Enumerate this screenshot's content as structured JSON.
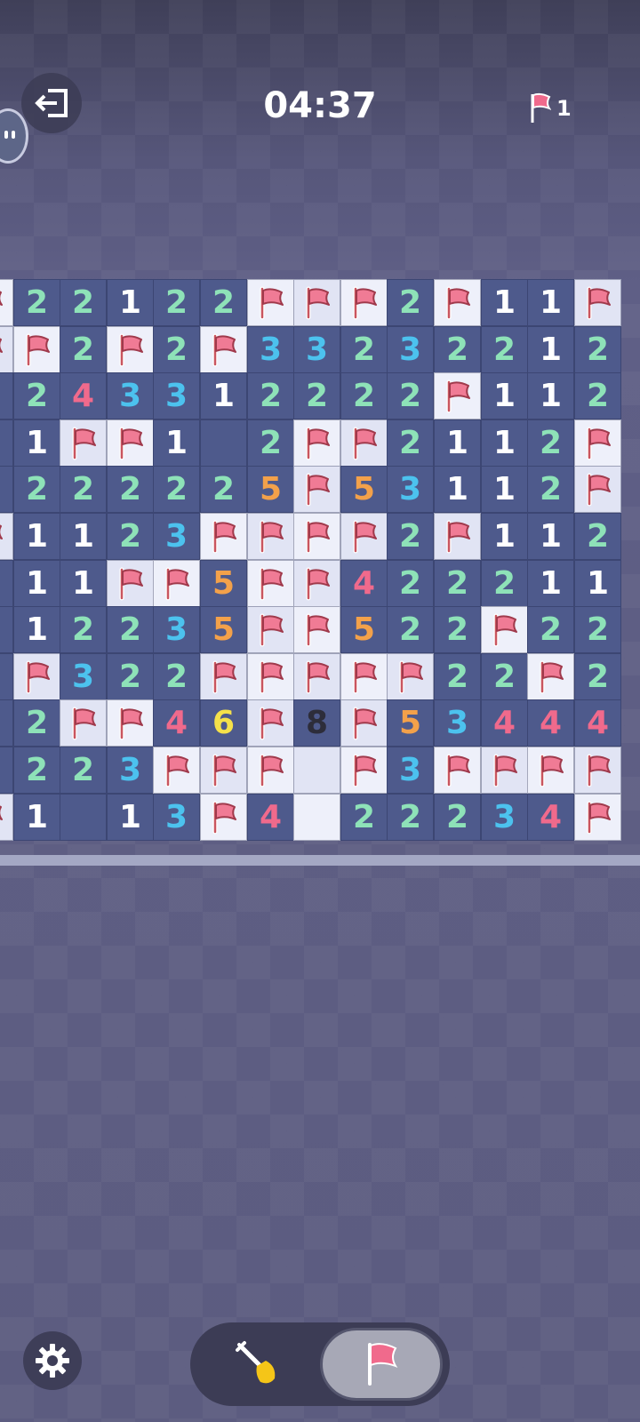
{
  "header": {
    "timer": "04:37",
    "flag_count": "1"
  },
  "mode": {
    "selected": "flag"
  },
  "board": {
    "rows": [
      [
        "F",
        "2",
        "2",
        "1",
        "2",
        "2",
        "F",
        "F",
        "F",
        "2",
        "F",
        "1",
        "1",
        "F"
      ],
      [
        "F",
        "F",
        "2",
        "F",
        "2",
        "F",
        "3",
        "3",
        "2",
        "3",
        "2",
        "2",
        "1",
        "2"
      ],
      [
        "",
        "2",
        "4",
        "3",
        "3",
        "1",
        "2",
        "2",
        "2",
        "2",
        "F",
        "1",
        "1",
        "2"
      ],
      [
        "",
        "1",
        "F",
        "F",
        "1",
        "",
        "2",
        "F",
        "F",
        "2",
        "1",
        "1",
        "2",
        "F"
      ],
      [
        "",
        "2",
        "2",
        "2",
        "2",
        "2",
        "5",
        "F",
        "5",
        "3",
        "1",
        "1",
        "2",
        "F"
      ],
      [
        "F",
        "1",
        "1",
        "2",
        "3",
        "F",
        "F",
        "F",
        "F",
        "2",
        "F",
        "1",
        "1",
        "2"
      ],
      [
        "",
        "1",
        "1",
        "F",
        "F",
        "5",
        "F",
        "F",
        "4",
        "2",
        "2",
        "2",
        "1",
        "1"
      ],
      [
        "",
        "1",
        "2",
        "2",
        "3",
        "5",
        "F",
        "F",
        "5",
        "2",
        "2",
        "F",
        "2",
        "2"
      ],
      [
        "",
        "F",
        "3",
        "2",
        "2",
        "F",
        "F",
        "F",
        "F",
        "F",
        "2",
        "2",
        "F",
        "2"
      ],
      [
        "",
        "2",
        "F",
        "F",
        "4",
        "6",
        "F",
        "8",
        "F",
        "5",
        "3",
        "4",
        "4",
        "4"
      ],
      [
        "",
        "2",
        "2",
        "3",
        "F",
        "F",
        "F",
        "L",
        "F",
        "3",
        "F",
        "F",
        "F",
        "F"
      ],
      [
        "F",
        "1",
        "",
        "1",
        "3",
        "F",
        "4",
        "L",
        "2",
        "2",
        "2",
        "3",
        "4",
        "F"
      ]
    ]
  },
  "icons": {
    "exit": "exit-icon",
    "flag": "flag-icon",
    "gear": "gear-icon",
    "shovel": "shovel-icon"
  }
}
